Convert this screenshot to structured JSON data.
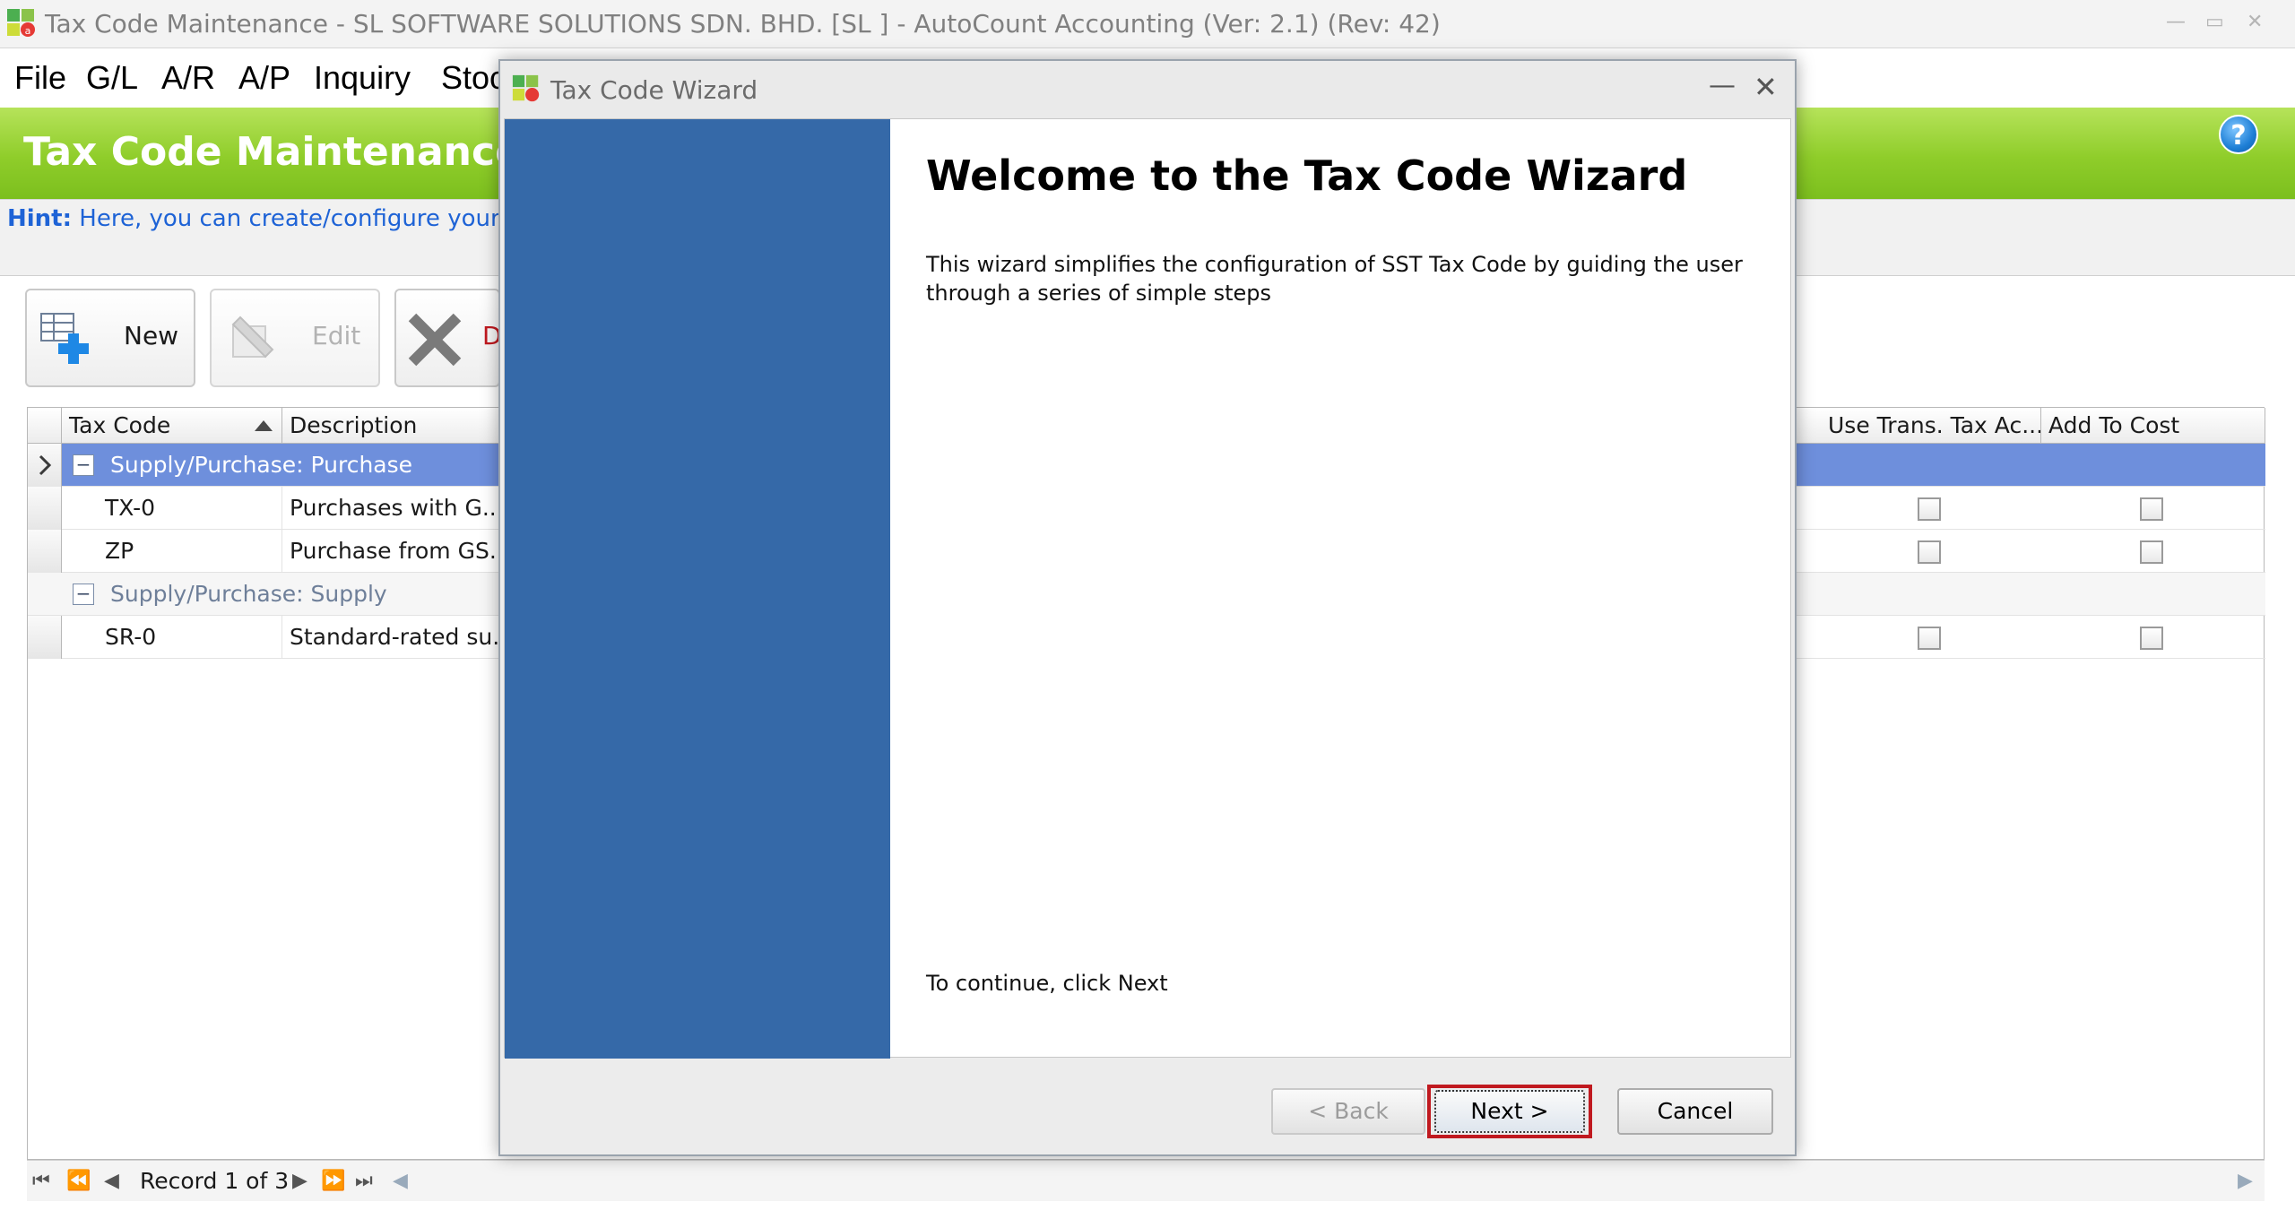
{
  "window": {
    "title": "Tax Code Maintenance - SL SOFTWARE SOLUTIONS SDN. BHD. [SL ] - AutoCount Accounting (Ver: 2.1) (Rev: 42)",
    "controls": {
      "minimize": "—",
      "restore": "▭",
      "close": "✕"
    }
  },
  "menu": [
    "File",
    "G/L",
    "A/R",
    "A/P",
    "Inquiry",
    "Stoc"
  ],
  "header": {
    "title": "Tax Code Maintenance",
    "help": "?"
  },
  "hint": {
    "label": "Hint:",
    "text": "Here, you can create/configure your tax"
  },
  "toolbar": {
    "new_label": "New",
    "edit_label": "Edit",
    "delete_label": "D"
  },
  "grid": {
    "columns": {
      "tax_code": "Tax Code",
      "description": "Description",
      "use_trans": "Use Trans. Tax Ac...",
      "add_to_cost": "Add To Cost"
    },
    "groups": [
      {
        "label": "Supply/Purchase: Purchase",
        "collapse": "−",
        "rows": [
          {
            "code": "TX-0",
            "description": "Purchases with G..."
          },
          {
            "code": "ZP",
            "description": "Purchase from GS..."
          }
        ]
      },
      {
        "label": "Supply/Purchase: Supply",
        "collapse": "−",
        "rows": [
          {
            "code": "SR-0",
            "description": "Standard-rated su..."
          }
        ]
      }
    ]
  },
  "navigator": {
    "record_text": "Record 1 of 3"
  },
  "dialog": {
    "title": "Tax Code Wizard",
    "heading": "Welcome to the Tax Code Wizard",
    "description": "This wizard simplifies the configuration of SST Tax Code by guiding the user through a series of simple steps",
    "continue_text": "To continue, click Next",
    "back_label": "< Back",
    "next_label": "Next >",
    "cancel_label": "Cancel",
    "minimize": "—",
    "close": "✕"
  },
  "colors": {
    "green_header": "#8fcd2a",
    "sidebar_blue": "#3569a8",
    "selected_row": "#6e8fdc",
    "hint_blue": "#1e63d6",
    "highlight_red": "#c0191f"
  }
}
